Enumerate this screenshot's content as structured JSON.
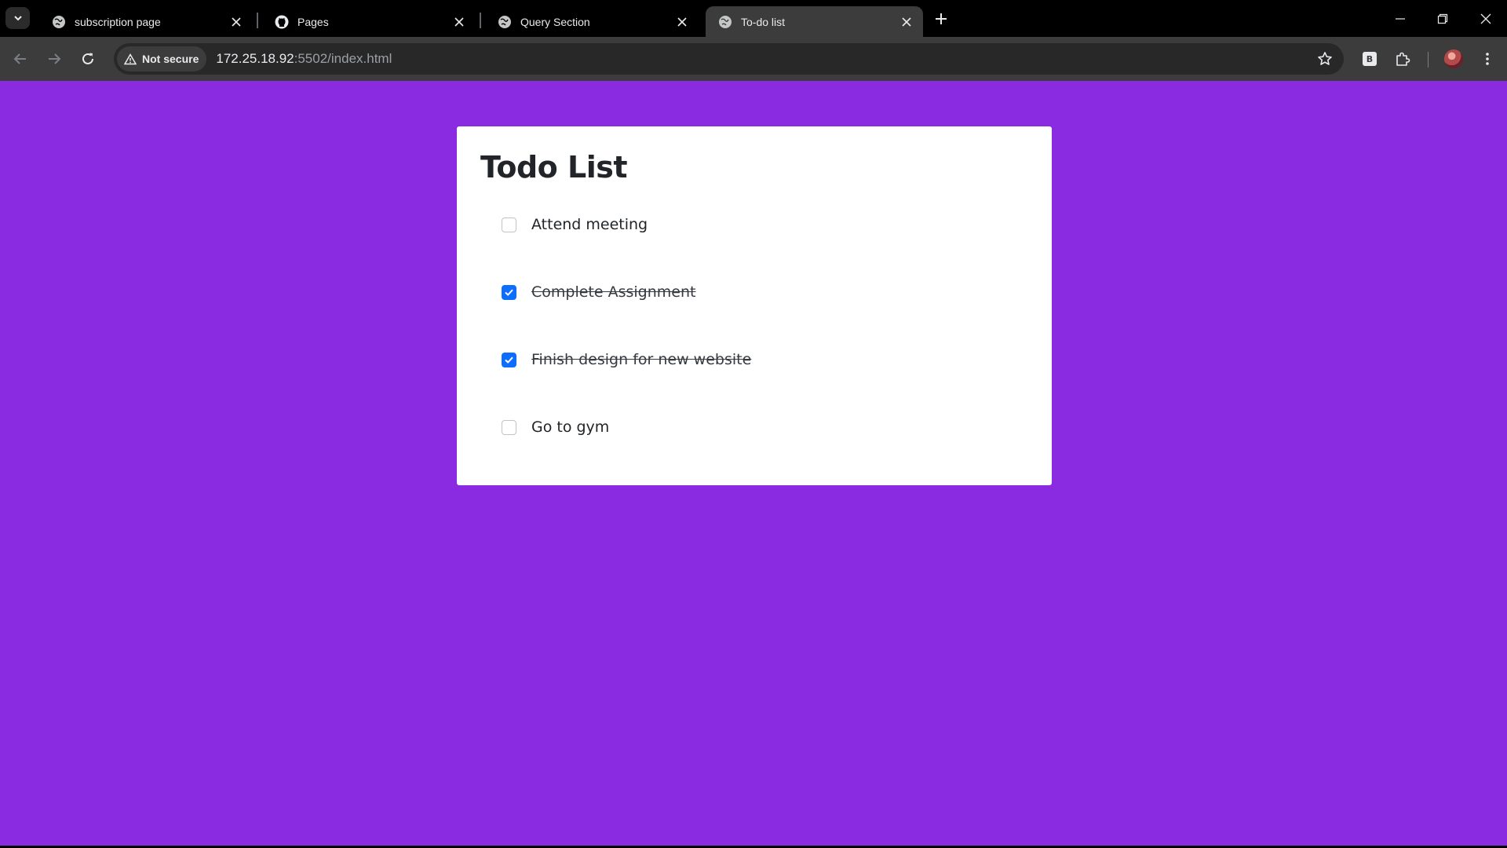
{
  "browser": {
    "tabs": [
      {
        "title": "subscription page",
        "favicon": "globe-icon",
        "active": false
      },
      {
        "title": "Pages",
        "favicon": "github-icon",
        "active": false
      },
      {
        "title": "Query Section",
        "favicon": "globe-icon",
        "active": false
      },
      {
        "title": "To-do list",
        "favicon": "globe-icon",
        "active": true
      }
    ],
    "security_chip": "Not secure",
    "url_host": "172.25.18.92",
    "url_rest": ":5502/index.html",
    "extension_label": "B"
  },
  "page": {
    "background": "#8a2be2",
    "heading": "Todo List",
    "todos": [
      {
        "label": "Attend meeting",
        "checked": false
      },
      {
        "label": "Complete Assignment",
        "checked": true
      },
      {
        "label": "Finish design for new website",
        "checked": true
      },
      {
        "label": "Go to gym",
        "checked": false
      }
    ],
    "checkbox_color": "#0d6efd"
  }
}
